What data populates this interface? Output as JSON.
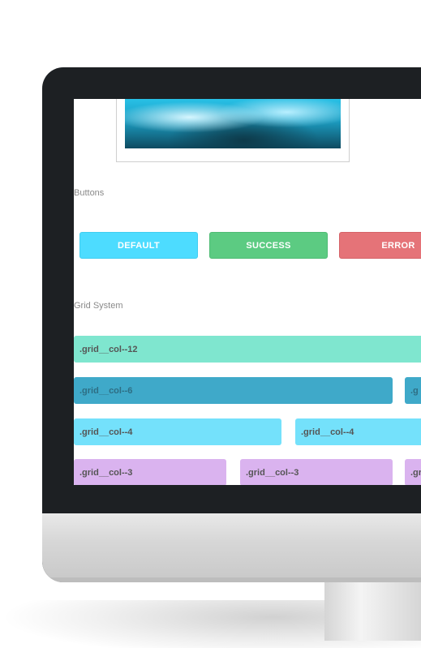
{
  "sections": {
    "buttons_label": "Buttons",
    "grid_label": "Grid System"
  },
  "buttons": [
    {
      "label": "DEFAULT",
      "color": "#4ddcff"
    },
    {
      "label": "SUCCESS",
      "color": "#5ccb82"
    },
    {
      "label": "ERROR",
      "color": "#e57378"
    }
  ],
  "grid": {
    "row12": [
      ".grid__col--12"
    ],
    "row6": [
      ".grid__col--6",
      ".g"
    ],
    "row4": [
      ".grid__col--4",
      ".grid__col--4"
    ],
    "row3": [
      ".grid__col--3",
      ".grid__col--3",
      ".gr"
    ]
  },
  "colors": {
    "bezel": "#1d2023",
    "col12": "#7fe6cf",
    "col6": "#3fa9c9",
    "col4": "#74e1fb",
    "col3": "#dab3ef"
  }
}
